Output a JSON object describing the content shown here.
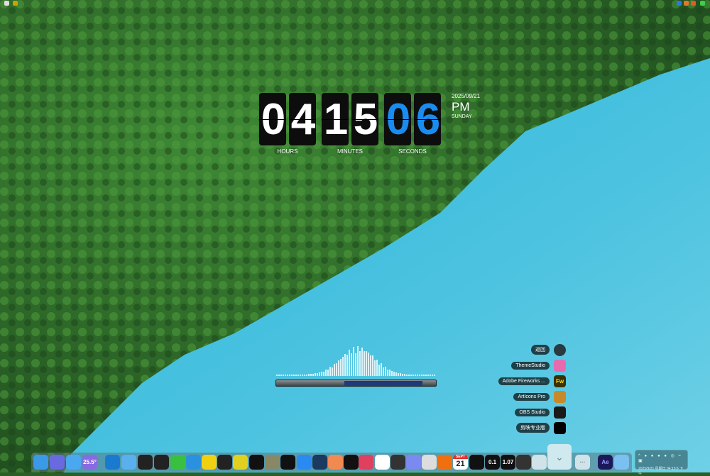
{
  "clock": {
    "hours": [
      "0",
      "4"
    ],
    "minutes": [
      "1",
      "5"
    ],
    "seconds": [
      "0",
      "6"
    ],
    "hours_label": "HOURS",
    "minutes_label": "MINUTES",
    "seconds_label": "SECONDS",
    "date": "2025/09/21",
    "ampm": "PM",
    "weekday": "SUNDAY",
    "seconds_color": "#1a8cf0"
  },
  "stack_menu": [
    {
      "label": "返回",
      "icon": "back-arrow-icon",
      "color": "#2a3a40"
    },
    {
      "label": "ThemeStudio",
      "icon": "themestudio-icon",
      "color": "#e86bb0"
    },
    {
      "label": "Adobe Fireworks ...",
      "icon": "fireworks-icon",
      "color": "#3a3000",
      "glyph": "Fw"
    },
    {
      "label": "ArtIcons Pro",
      "icon": "articons-icon",
      "color": "#c78a2a"
    },
    {
      "label": "OBS Studio",
      "icon": "obs-icon",
      "color": "#1a1a1a"
    },
    {
      "label": "剪映专业版",
      "icon": "capcut-icon",
      "color": "#000000"
    }
  ],
  "dock": {
    "weather_temp": "25.5°",
    "calendar_month": "SEPT",
    "calendar_day": "21",
    "net_up": "0.1",
    "net_down": "1.07",
    "ae_label": "Ae",
    "more": "···"
  },
  "tray": {
    "datetime": "2025/9/21 星期日 04:15:6 下午"
  }
}
